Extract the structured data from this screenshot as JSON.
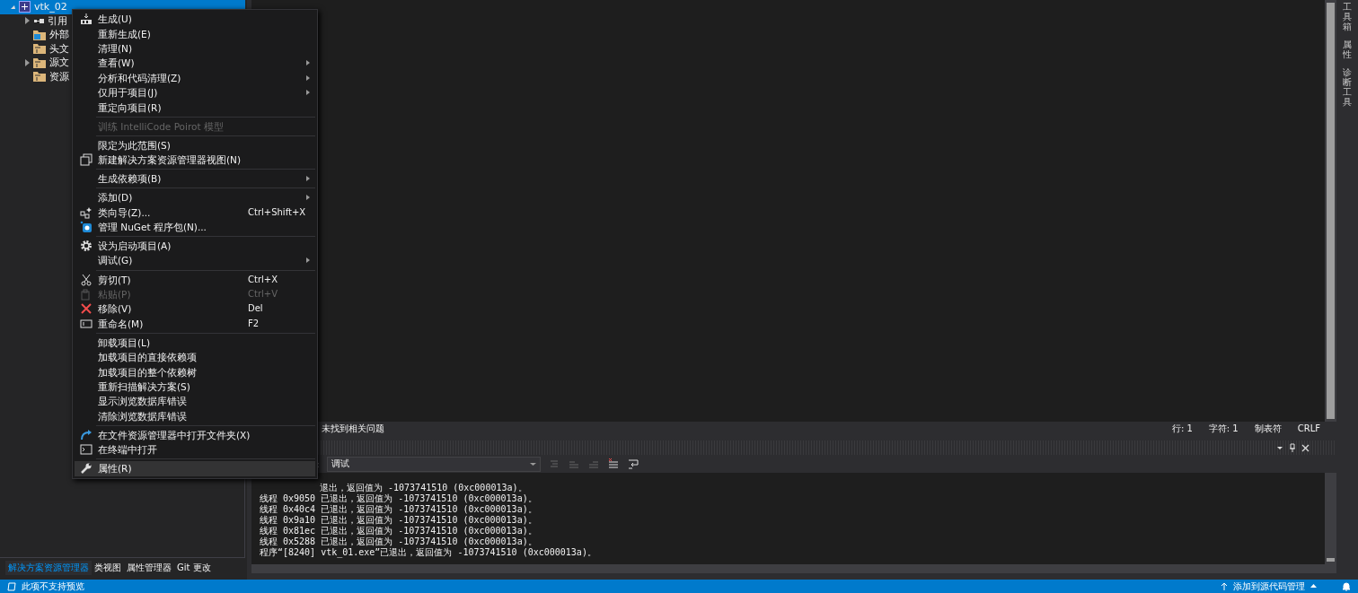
{
  "explorer": {
    "root": {
      "label": "vtk_02",
      "expanded": true,
      "selected": true
    },
    "children": [
      {
        "label": "引用",
        "expandable": true,
        "kind": "references"
      },
      {
        "label": "外部",
        "expandable": false,
        "kind": "external"
      },
      {
        "label": "头文",
        "expandable": false,
        "kind": "filter"
      },
      {
        "label": "源文",
        "expandable": true,
        "kind": "filter"
      },
      {
        "label": "资源",
        "expandable": false,
        "kind": "filter"
      }
    ],
    "tabs": [
      {
        "label": "解决方案资源管理器",
        "selected": true
      },
      {
        "label": "类视图",
        "selected": false
      },
      {
        "label": "属性管理器",
        "selected": false
      },
      {
        "label": "Git 更改",
        "selected": false
      }
    ]
  },
  "context_menu": [
    {
      "kind": "build",
      "label": "生成(U)",
      "selected": false,
      "disabled": false,
      "submenu": false
    },
    {
      "kind": "plain",
      "label": "重新生成(E)",
      "selected": false,
      "disabled": false,
      "submenu": false
    },
    {
      "kind": "plain",
      "label": "清理(N)",
      "selected": false,
      "disabled": false,
      "submenu": false
    },
    {
      "kind": "plain",
      "label": "查看(W)",
      "selected": false,
      "disabled": false,
      "submenu": true
    },
    {
      "kind": "plain",
      "label": "分析和代码清理(Z)",
      "selected": false,
      "disabled": false,
      "submenu": true
    },
    {
      "kind": "plain",
      "label": "仅用于项目(J)",
      "selected": false,
      "disabled": false,
      "submenu": true
    },
    {
      "kind": "plain",
      "label": "重定向项目(R)",
      "selected": false,
      "disabled": false,
      "submenu": false
    },
    {
      "kind": "separator"
    },
    {
      "kind": "plain",
      "label": "训练 IntelliCode Poirot 模型",
      "selected": false,
      "disabled": true,
      "submenu": false
    },
    {
      "kind": "separator"
    },
    {
      "kind": "plain",
      "label": "限定为此范围(S)",
      "selected": false,
      "disabled": false,
      "submenu": false
    },
    {
      "kind": "windows",
      "label": "新建解决方案资源管理器视图(N)",
      "selected": false,
      "disabled": false,
      "submenu": false
    },
    {
      "kind": "separator"
    },
    {
      "kind": "plain",
      "label": "生成依赖项(B)",
      "selected": false,
      "disabled": false,
      "submenu": true
    },
    {
      "kind": "separator"
    },
    {
      "kind": "plain",
      "label": "添加(D)",
      "selected": false,
      "disabled": false,
      "submenu": true
    },
    {
      "kind": "wizard",
      "label": "类向导(Z)...",
      "shortcut": "Ctrl+Shift+X",
      "selected": false,
      "disabled": false,
      "submenu": false
    },
    {
      "kind": "package",
      "label": "管理 NuGet 程序包(N)...",
      "selected": false,
      "disabled": false,
      "submenu": false
    },
    {
      "kind": "separator"
    },
    {
      "kind": "gear",
      "label": "设为启动项目(A)",
      "selected": false,
      "disabled": false,
      "submenu": false
    },
    {
      "kind": "plain",
      "label": "调试(G)",
      "selected": false,
      "disabled": false,
      "submenu": true
    },
    {
      "kind": "separator"
    },
    {
      "kind": "scissors",
      "label": "剪切(T)",
      "shortcut": "Ctrl+X",
      "selected": false,
      "disabled": false,
      "submenu": false
    },
    {
      "kind": "clipboard",
      "label": "粘贴(P)",
      "shortcut": "Ctrl+V",
      "selected": false,
      "disabled": true,
      "submenu": false
    },
    {
      "kind": "cross",
      "label": "移除(V)",
      "shortcut": "Del",
      "selected": false,
      "disabled": false,
      "submenu": false
    },
    {
      "kind": "rename",
      "label": "重命名(M)",
      "shortcut": "F2",
      "selected": false,
      "disabled": false,
      "submenu": false
    },
    {
      "kind": "separator"
    },
    {
      "kind": "plain",
      "label": "卸载项目(L)",
      "selected": false,
      "disabled": false,
      "submenu": false
    },
    {
      "kind": "plain",
      "label": "加载项目的直接依赖项",
      "selected": false,
      "disabled": false,
      "submenu": false
    },
    {
      "kind": "plain",
      "label": "加载项目的整个依赖树",
      "selected": false,
      "disabled": false,
      "submenu": false
    },
    {
      "kind": "plain",
      "label": "重新扫描解决方案(S)",
      "selected": false,
      "disabled": false,
      "submenu": false
    },
    {
      "kind": "plain",
      "label": "显示浏览数据库错误",
      "selected": false,
      "disabled": false,
      "submenu": false
    },
    {
      "kind": "plain",
      "label": "清除浏览数据库错误",
      "selected": false,
      "disabled": false,
      "submenu": false
    },
    {
      "kind": "separator"
    },
    {
      "kind": "arrow",
      "label": "在文件资源管理器中打开文件夹(X)",
      "selected": false,
      "disabled": false,
      "submenu": false
    },
    {
      "kind": "terminal",
      "label": "在终端中打开",
      "selected": false,
      "disabled": false,
      "submenu": false
    },
    {
      "kind": "separator"
    },
    {
      "kind": "wrench",
      "label": "属性(R)",
      "selected": true,
      "disabled": false,
      "submenu": false
    }
  ],
  "editor_status": {
    "message": "未找到相关问题",
    "line": "行: 1",
    "char": "字符: 1",
    "indent": "制表符",
    "eol": "CRLF"
  },
  "output": {
    "source_label": ":",
    "source": "调试",
    "partial_line": "退出，返回值为 -1073741510 (0xc000013a)。",
    "lines": [
      "线程 0x9050 已退出，返回值为 -1073741510 (0xc000013a)。",
      "线程 0x40c4 已退出，返回值为 -1073741510 (0xc000013a)。",
      "线程 0x9a10 已退出，返回值为 -1073741510 (0xc000013a)。",
      "线程 0x81ec 已退出，返回值为 -1073741510 (0xc000013a)。",
      "线程 0x5288 已退出，返回值为 -1073741510 (0xc000013a)。",
      "程序“[8240] vtk_01.exe”已退出，返回值为 -1073741510 (0xc000013a)。"
    ]
  },
  "side_tabs": [
    "工具箱",
    "属性",
    "诊断工具"
  ],
  "status_bar": {
    "left": "此项不支持预览",
    "right": "添加到源代码管理"
  }
}
